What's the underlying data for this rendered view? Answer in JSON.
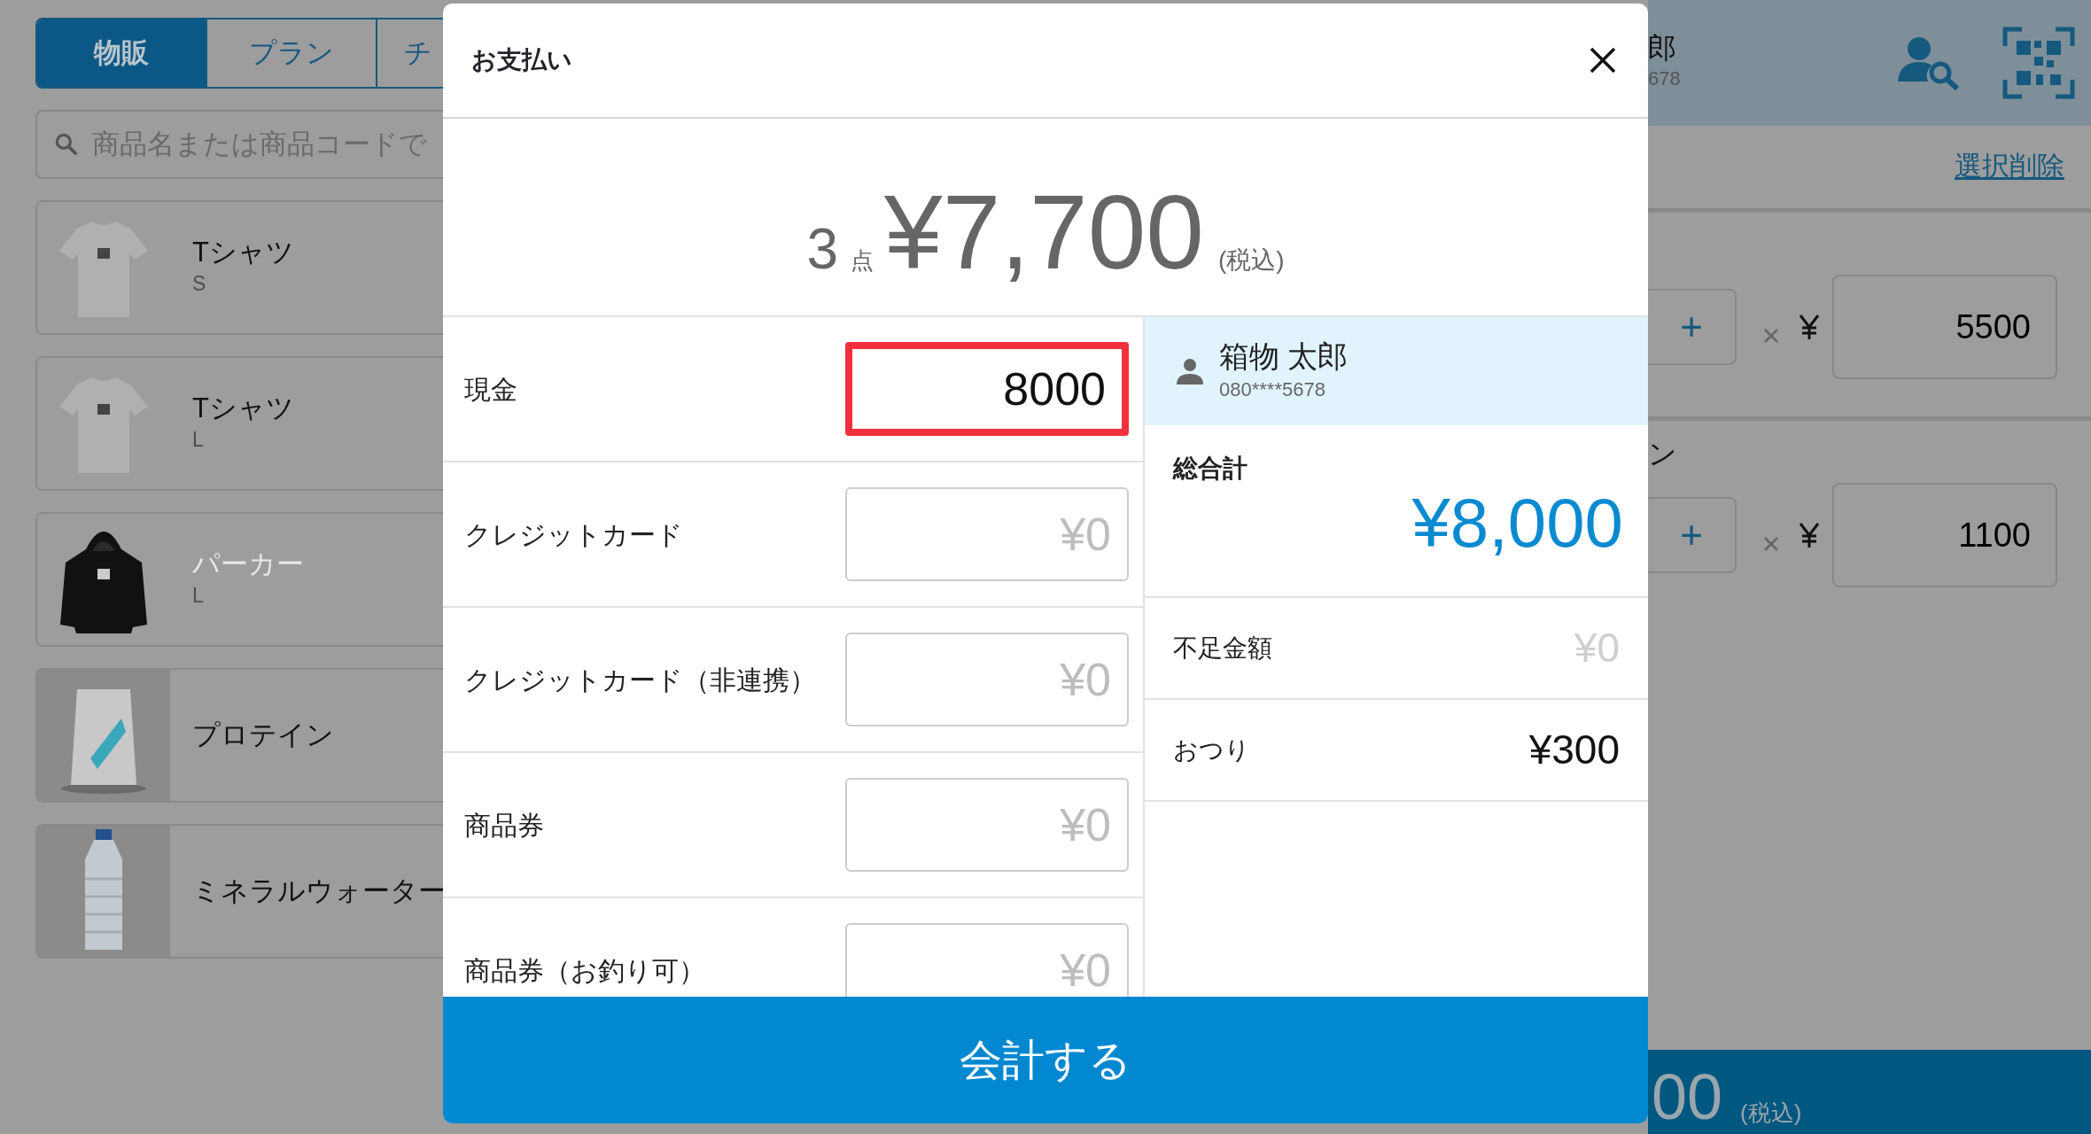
{
  "background": {
    "tabs": [
      {
        "label": "物販",
        "selected": true
      },
      {
        "label": "プラン",
        "selected": false
      },
      {
        "label": "チ",
        "selected": false
      }
    ],
    "search": {
      "placeholder": "商品名または商品コードで"
    },
    "products": [
      {
        "name": "Tシャツ",
        "variant": "S",
        "disabled": false
      },
      {
        "name": "Tシャツ",
        "variant": "L",
        "disabled": false
      },
      {
        "name": "パーカー",
        "variant": "L",
        "disabled": true
      },
      {
        "name": "プロテイン",
        "disabled": false
      },
      {
        "name": "ミネラルウォーター",
        "disabled": false
      }
    ],
    "customer": {
      "name": "郎",
      "phone": "678"
    },
    "clear_selection": "選択削除",
    "cart_rows": [
      {
        "increment": "+",
        "price": "5500"
      },
      {
        "name": "ン",
        "increment": "+",
        "price": "1100"
      }
    ],
    "total_bar": {
      "amount": "00",
      "tax_note": "(税込)"
    }
  },
  "modal": {
    "title": "お支払い",
    "summary": {
      "count": "3",
      "count_unit": "点",
      "amount": "¥7,700",
      "tax_note": "(税込)"
    },
    "payments": [
      {
        "label": "現金",
        "value": "8000",
        "highlighted": true
      },
      {
        "label": "クレジットカード",
        "placeholder": "¥0",
        "highlighted": false
      },
      {
        "label": "クレジットカード（非連携）",
        "placeholder": "¥0",
        "highlighted": false
      },
      {
        "label": "商品券",
        "placeholder": "¥0",
        "highlighted": false
      },
      {
        "label": "商品券（お釣り可）",
        "placeholder": "¥0",
        "highlighted": false
      }
    ],
    "customer": {
      "name": "箱物 太郎",
      "phone": "080****5678"
    },
    "grand_total": {
      "label": "総合計",
      "amount": "¥8,000"
    },
    "shortage": {
      "label": "不足金額",
      "amount": "¥0"
    },
    "change": {
      "label": "おつり",
      "amount": "¥300"
    },
    "submit": "会計する"
  }
}
